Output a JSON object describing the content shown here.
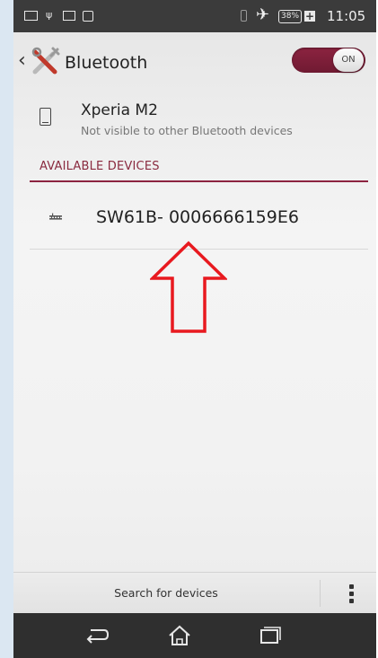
{
  "status_bar": {
    "time": "11:05",
    "battery_percent": "38%",
    "battery_charging_glyph": "+",
    "icons": [
      "notification-icon",
      "usb-icon",
      "screenshot-icon",
      "gallery-icon",
      "vibrate-icon",
      "airplane-mode-icon",
      "battery-icon"
    ]
  },
  "action_bar": {
    "title": "Bluetooth",
    "toggle_label": "ON",
    "toggle_on": true,
    "accent_color": "#8c2340"
  },
  "this_device": {
    "name": "Xperia M2",
    "status": "Not visible to other Bluetooth devices"
  },
  "available_devices": {
    "header": "AVAILABLE DEVICES",
    "items": [
      {
        "name": "SW61B- 0006666159E6",
        "icon": "keyboard-icon"
      }
    ]
  },
  "annotation": {
    "icon": "arrow-up-outline",
    "color": "#e8191f"
  },
  "bottom_bar": {
    "search_label": "Search for devices",
    "overflow_icon": "more-vertical-icon"
  },
  "nav_bar": {
    "buttons": [
      "back-icon",
      "home-icon",
      "recent-apps-icon"
    ]
  }
}
